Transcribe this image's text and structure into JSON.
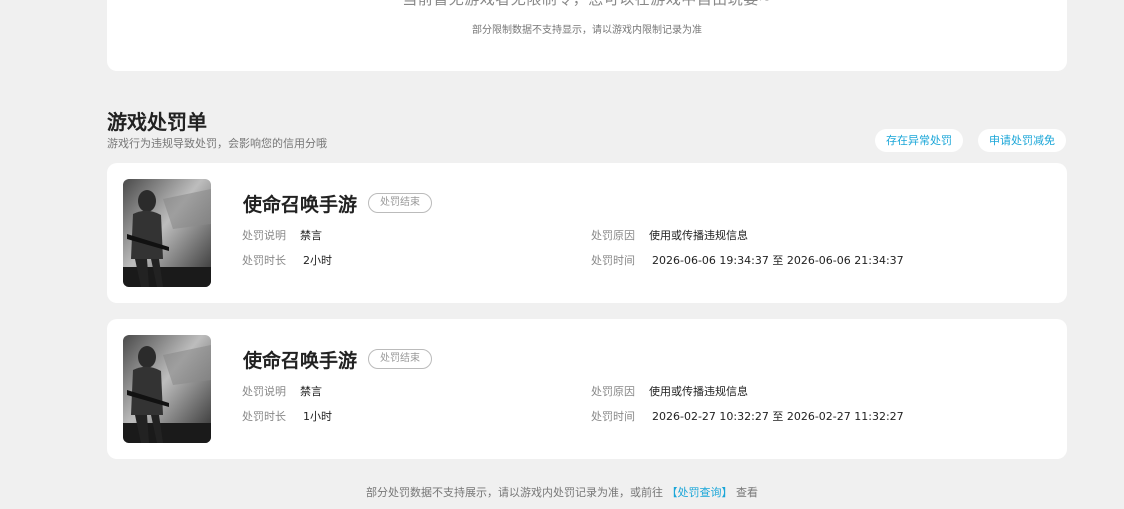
{
  "top_card": {
    "main_text": "当前暂无游戏者无限制令，您可以在游戏中自由玩耍~",
    "sub_text": "部分限制数据不支持显示，请以游戏内限制记录为准"
  },
  "section": {
    "title": "游戏处罚单",
    "subtitle": "游戏行为违规导致处罚，会影响您的信用分哦",
    "abnormal_button": "存在异常处罚",
    "reduce_button": "申请处罚减免"
  },
  "labels": {
    "description": "处罚说明",
    "duration": "处罚时长",
    "reason": "处罚原因",
    "time": "处罚时间"
  },
  "records": [
    {
      "game": "使命召唤手游",
      "status": "处罚结束",
      "description": "禁言",
      "duration": "2小时",
      "reason": "使用或传播违规信息",
      "time": "2026-06-06 19:34:37 至 2026-06-06 21:34:37"
    },
    {
      "game": "使命召唤手游",
      "status": "处罚结束",
      "description": "禁言",
      "duration": "1小时",
      "reason": "使用或传播违规信息",
      "time": "2026-02-27 10:32:27 至 2026-02-27 11:32:27"
    }
  ],
  "footer": {
    "prefix": "部分处罚数据不支持展示，请以游戏内处罚记录为准，或前往",
    "link": "【处罚查询】",
    "suffix": "查看"
  },
  "colors": {
    "accent": "#1aa6d8",
    "background": "#f0f0f0"
  }
}
